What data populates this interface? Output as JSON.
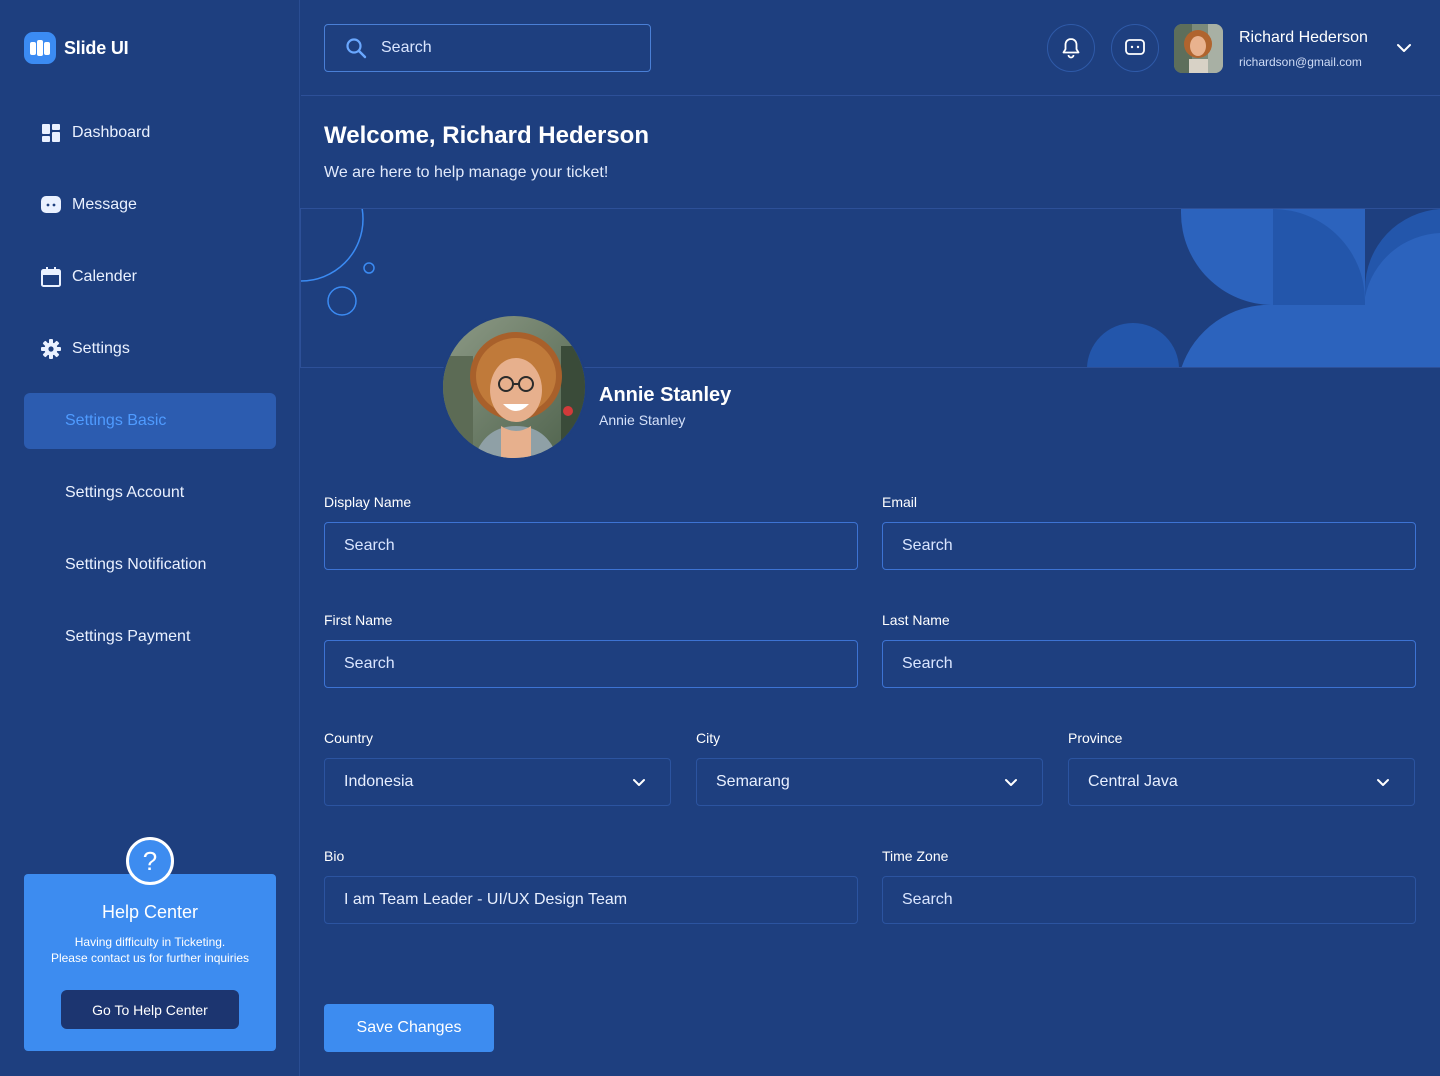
{
  "app": {
    "name": "Slide UI"
  },
  "sidebar": {
    "items": [
      {
        "label": "Dashboard",
        "icon": "dashboard-icon"
      },
      {
        "label": "Message",
        "icon": "message-icon"
      },
      {
        "label": "Calender",
        "icon": "calendar-icon"
      },
      {
        "label": "Settings",
        "icon": "gear-icon"
      }
    ],
    "sub_items": [
      {
        "label": "Settings Basic",
        "active": true
      },
      {
        "label": "Settings Account",
        "active": false
      },
      {
        "label": "Settings Notification",
        "active": false
      },
      {
        "label": "Settings Payment",
        "active": false
      }
    ],
    "help": {
      "icon": "question-icon",
      "title": "Help Center",
      "text_line1": "Having difficulty in Ticketing.",
      "text_line2": "Please contact us for further inquiries",
      "button": "Go To Help Center"
    }
  },
  "header": {
    "search_placeholder": "Search",
    "user_name": "Richard Hederson",
    "user_email": "richardson@gmail.com"
  },
  "welcome": {
    "title": "Welcome, Richard Hederson",
    "subtitle": "We are here to help manage your ticket!"
  },
  "profile": {
    "name": "Annie Stanley",
    "subname": "Annie Stanley"
  },
  "form": {
    "display_name": {
      "label": "Display Name",
      "placeholder": "Search"
    },
    "email": {
      "label": "Email",
      "placeholder": "Search"
    },
    "first_name": {
      "label": "First Name",
      "placeholder": "Search"
    },
    "last_name": {
      "label": "Last Name",
      "placeholder": "Search"
    },
    "country": {
      "label": "Country",
      "value": "Indonesia"
    },
    "city": {
      "label": "City",
      "value": "Semarang"
    },
    "province": {
      "label": "Province",
      "value": "Central Java"
    },
    "bio": {
      "label": "Bio",
      "value": "I am Team Leader - UI/UX Design Team"
    },
    "time_zone": {
      "label": "Time Zone",
      "placeholder": "Search"
    },
    "save_label": "Save Changes"
  },
  "colors": {
    "background": "#1e3f7f",
    "accent": "#3d8cf0",
    "active_item_bg": "#2c5cb0",
    "active_item_text": "#4f9bff",
    "input_border": "#3d73d3"
  }
}
